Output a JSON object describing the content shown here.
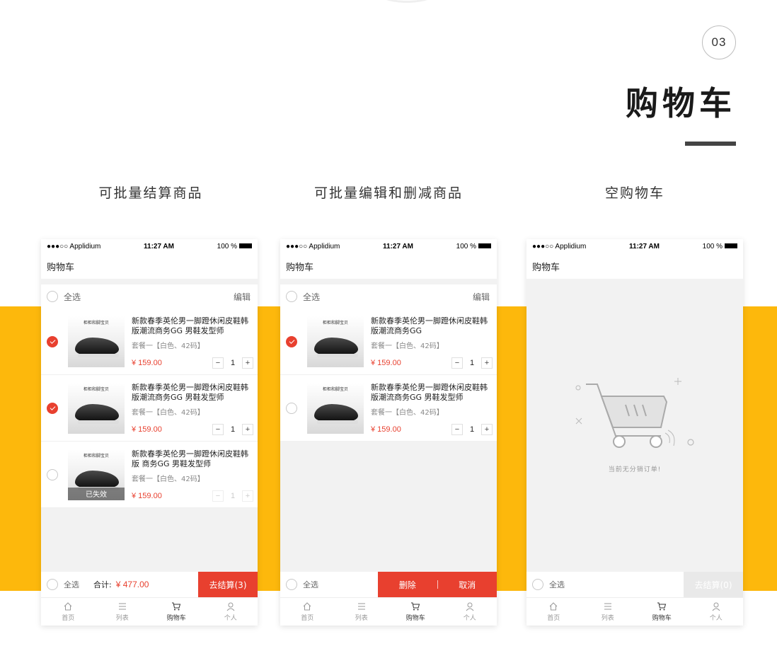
{
  "header": {
    "page_number": "03",
    "title": "购物车"
  },
  "captions": [
    "可批量结算商品",
    "可批量编辑和删减商品",
    "空购物车"
  ],
  "colors": {
    "accent": "#e8402f",
    "band": "#fdb80c"
  },
  "status": {
    "carrier": "●●●○○ Applidium",
    "time": "11:27 AM",
    "battery": "100 %"
  },
  "nav_title": "购物车",
  "select_all": "全选",
  "edit": "编辑",
  "thumb_tag": "柜柜和脚宝贝",
  "sku": "套餐一【白色、42码】",
  "price": "¥ 159.00",
  "invalid_tag": "已失效",
  "screen1": {
    "items": [
      {
        "name": "新款春季英伦男一脚蹬休闲皮鞋韩版潮流商务GG 男鞋发型师",
        "qty": "1",
        "checked": true
      },
      {
        "name": "新款春季英伦男一脚蹬休闲皮鞋韩版潮流商务GG 男鞋发型师",
        "qty": "1",
        "checked": true
      },
      {
        "name": "新款春季英伦男一脚蹬休闲皮鞋韩版 商务GG 男鞋发型师",
        "qty": "1",
        "checked": false
      }
    ],
    "total_label": "合计:",
    "total_value": "¥ 477.00",
    "checkout": "去结算(3)"
  },
  "screen2": {
    "items": [
      {
        "name": "新款春季英伦男一脚蹬休闲皮鞋韩版潮流商务GG",
        "qty": "1",
        "checked": true
      },
      {
        "name": "新款春季英伦男一脚蹬休闲皮鞋韩版潮流商务GG 男鞋发型师",
        "qty": "1",
        "checked": false
      }
    ],
    "delete": "删除",
    "cancel": "取消"
  },
  "screen3": {
    "empty_text": "当前无分销订单!",
    "checkout": "去结算(0)"
  },
  "tabs": [
    {
      "label": "首页",
      "icon": "home-icon"
    },
    {
      "label": "列表",
      "icon": "list-icon"
    },
    {
      "label": "购物车",
      "icon": "cart-icon"
    },
    {
      "label": "个人",
      "icon": "person-icon"
    }
  ]
}
